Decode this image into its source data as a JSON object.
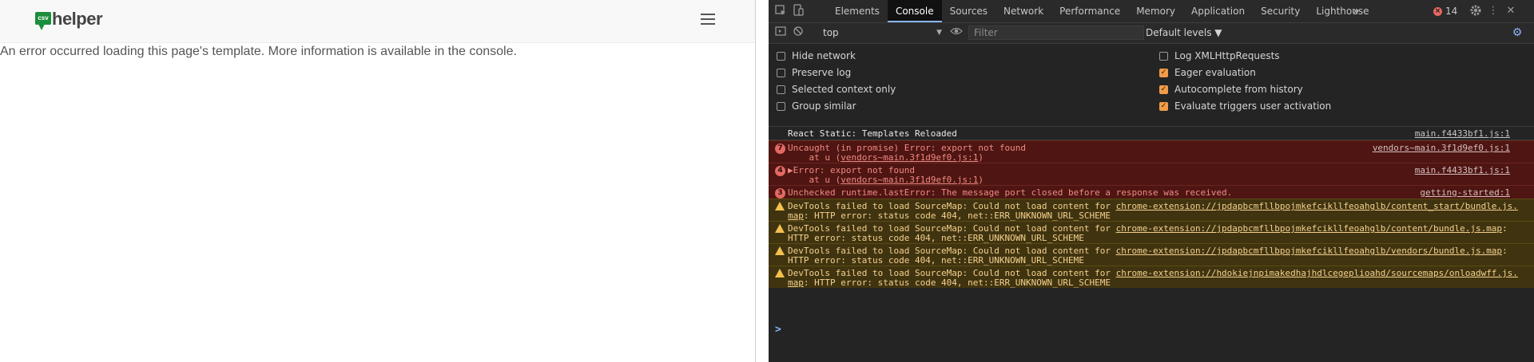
{
  "site": {
    "logo_badge": "csv",
    "logo_word": "helper",
    "error_message": "An error occurred loading this page's template. More information is available in the console."
  },
  "devtools": {
    "tabs": [
      "Elements",
      "Console",
      "Sources",
      "Network",
      "Performance",
      "Memory",
      "Application",
      "Security",
      "Lighthouse"
    ],
    "active_tab": "Console",
    "error_count": "14",
    "context": "top",
    "filter_placeholder": "Filter",
    "levels": "Default levels ▼",
    "options_left": [
      {
        "label": "Hide network",
        "checked": false
      },
      {
        "label": "Preserve log",
        "checked": false
      },
      {
        "label": "Selected context only",
        "checked": false
      },
      {
        "label": "Group similar",
        "checked": false
      }
    ],
    "options_right": [
      {
        "label": "Log XMLHttpRequests",
        "checked": false
      },
      {
        "label": "Eager evaluation",
        "checked": true
      },
      {
        "label": "Autocomplete from history",
        "checked": true
      },
      {
        "label": "Evaluate triggers user activation",
        "checked": true
      }
    ],
    "messages": [
      {
        "type": "info",
        "line1": "React Static: Templates Reloaded",
        "source": "main.f4433bf1.js:1"
      },
      {
        "type": "error",
        "count": "7",
        "line1": "Uncaught (in promise) Error: export not found",
        "line2_prefix": "    at u (",
        "line2_link": "vendors~main.3f1d9ef0.js:1",
        "line2_suffix": ")",
        "source": "vendors~main.3f1d9ef0.js:1"
      },
      {
        "type": "error",
        "count": "4",
        "line1": "▶Error: export not found",
        "line2_prefix": "    at u (",
        "line2_link": "vendors~main.3f1d9ef0.js:1",
        "line2_suffix": ")",
        "source": "main.f4433bf1.js:1"
      },
      {
        "type": "error",
        "count": "3",
        "line1": "Unchecked runtime.lastError: The message port closed before a response was received.",
        "source": "getting-started:1"
      },
      {
        "type": "warn",
        "line1_prefix": "DevTools failed to load SourceMap: Could not load content for ",
        "line1_link": "chrome-extension://jpdapbcmfllbpojmkefcikllfeoahglb/content_start/bundle.js.",
        "line2_link": "map",
        "line2_suffix": ": HTTP error: status code 404, net::ERR_UNKNOWN_URL_SCHEME"
      },
      {
        "type": "warn",
        "line1_prefix": "DevTools failed to load SourceMap: Could not load content for ",
        "line1_link": "chrome-extension://jpdapbcmfllbpojmkefcikllfeoahglb/content/bundle.js.map",
        "line1_suffix": ":",
        "line2_link": "",
        "line2_suffix": "HTTP error: status code 404, net::ERR_UNKNOWN_URL_SCHEME"
      },
      {
        "type": "warn",
        "line1_prefix": "DevTools failed to load SourceMap: Could not load content for ",
        "line1_link": "chrome-extension://jpdapbcmfllbpojmkefcikllfeoahglb/vendors/bundle.js.map",
        "line1_suffix": ":",
        "line2_link": "",
        "line2_suffix": "HTTP error: status code 404, net::ERR_UNKNOWN_URL_SCHEME"
      },
      {
        "type": "warn",
        "line1_prefix": "DevTools failed to load SourceMap: Could not load content for ",
        "line1_link": "chrome-extension://hdokiejnpimakedhajhdlcegeplioahd/sourcemaps/onloadwff.js.",
        "line2_link": "map",
        "line2_suffix": ": HTTP error: status code 404, net::ERR_UNKNOWN_URL_SCHEME"
      }
    ],
    "prompt_symbol": ">"
  }
}
